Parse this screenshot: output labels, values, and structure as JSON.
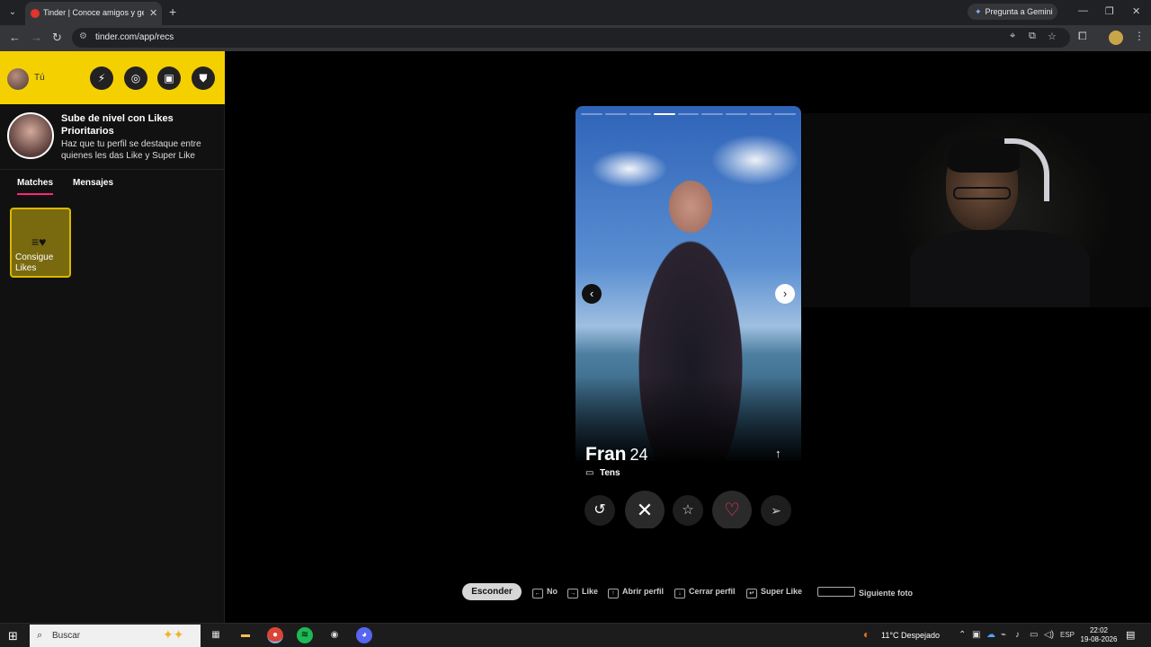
{
  "browser": {
    "tab_title": "Tinder | Conoce amigos y gente",
    "gemini_label": "Pregunta a Gemini",
    "url": "tinder.com/app/recs",
    "icons": [
      "tab-list-icon",
      "close-icon",
      "plus-icon",
      "sparkle-icon",
      "minimize-icon",
      "maximize-icon",
      "back-icon",
      "forward-icon",
      "reload-icon",
      "site-info-icon",
      "location-icon",
      "install-icon",
      "bookmark-star-icon",
      "extensions-icon",
      "menu-icon"
    ]
  },
  "sidebar": {
    "me_label": "Tú",
    "header_buttons": [
      {
        "name": "boost-button",
        "glyph": "⚡"
      },
      {
        "name": "explore-button",
        "glyph": "◎"
      },
      {
        "name": "work-button",
        "glyph": "▣"
      },
      {
        "name": "safety-button",
        "glyph": "⛊"
      }
    ],
    "promo": {
      "title": "Sube de nivel con Likes Prioritarios",
      "text": "Haz que tu perfil se destaque entre quienes les das Like y Super Like"
    },
    "tabs": [
      {
        "label": "Matches",
        "active": true
      },
      {
        "label": "Mensajes",
        "active": false
      }
    ],
    "likes_card": {
      "label": "Consigue Likes"
    }
  },
  "card": {
    "name": "Fran",
    "age": "24",
    "job": "Tens",
    "photo_count": 9,
    "active_photo": 4,
    "actions": [
      "rewind",
      "nope",
      "super-like",
      "like",
      "boost"
    ]
  },
  "shortcuts": {
    "hide_label": "Esconder",
    "items": [
      {
        "key": "←",
        "label": "No"
      },
      {
        "key": "→",
        "label": "Like"
      },
      {
        "key": "↑",
        "label": "Abrir perfil"
      },
      {
        "key": "↓",
        "label": "Cerrar perfil"
      },
      {
        "key": "↵",
        "label": "Super Like"
      },
      {
        "key": "",
        "label": "Siguiente foto"
      }
    ]
  },
  "taskbar": {
    "search_placeholder": "Buscar",
    "weather": "11°C  Despejado",
    "language": "ESP",
    "time": "22:02",
    "date": "19-08-2026"
  },
  "colors": {
    "tinder_yellow": "#f5d000",
    "active_tab_underline": "#fd267a",
    "like_red": "#fd3a5a"
  }
}
